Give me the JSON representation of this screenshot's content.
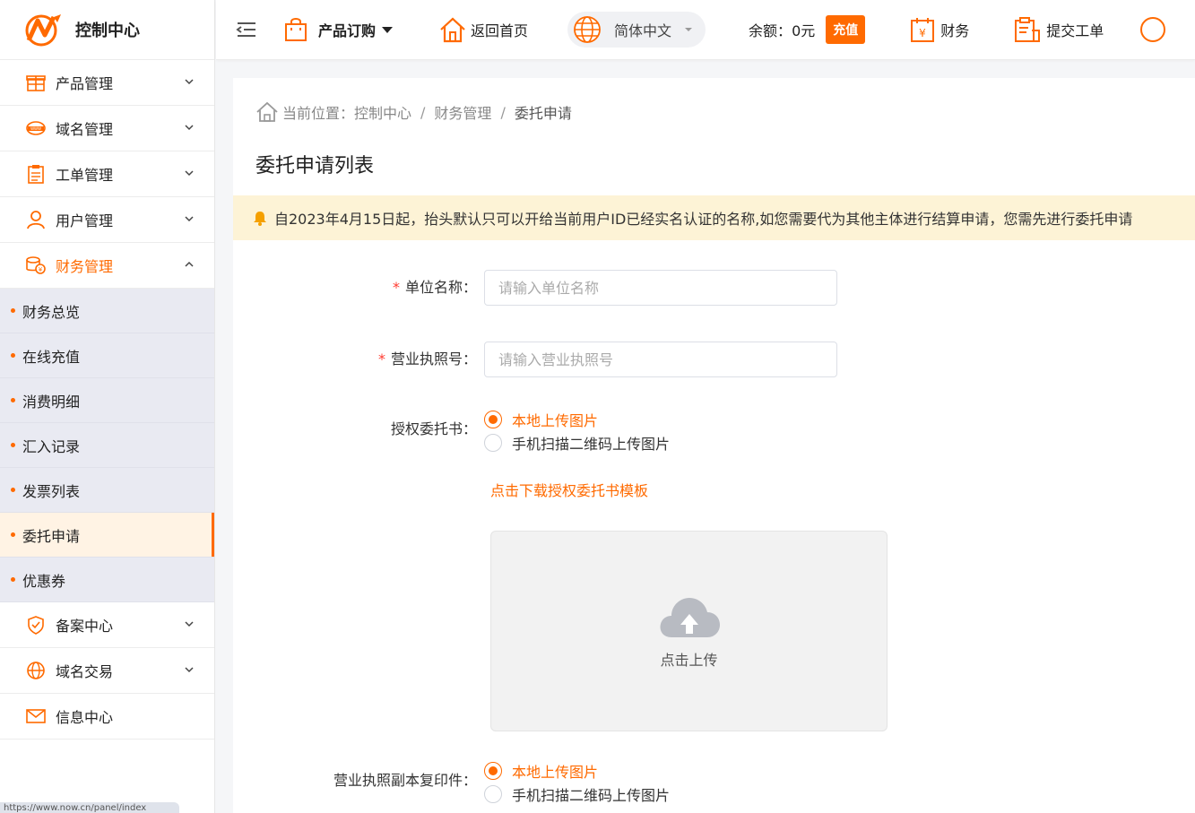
{
  "app": {
    "title": "控制中心"
  },
  "topbar": {
    "product_order": "产品订购",
    "home": "返回首页",
    "language": "简体中文",
    "balance_label": "余额：",
    "balance_value": "0元",
    "recharge": "充值",
    "finance": "财务",
    "ticket": "提交工单"
  },
  "sidebar": {
    "items": [
      {
        "label": "产品管理",
        "icon": "gift-box-icon"
      },
      {
        "label": "域名管理",
        "icon": "domain-icon"
      },
      {
        "label": "工单管理",
        "icon": "clipboard-icon"
      },
      {
        "label": "用户管理",
        "icon": "user-icon"
      },
      {
        "label": "财务管理",
        "icon": "coins-icon"
      },
      {
        "label": "备案中心",
        "icon": "shield-icon"
      },
      {
        "label": "域名交易",
        "icon": "globe-icon"
      },
      {
        "label": "信息中心",
        "icon": "mail-icon"
      }
    ],
    "finance_sub": [
      "财务总览",
      "在线充值",
      "消费明细",
      "汇入记录",
      "发票列表",
      "委托申请",
      "优惠券"
    ]
  },
  "status_bar": {
    "url": "https://www.now.cn/panel/index"
  },
  "breadcrumb": {
    "prefix": "当前位置：",
    "items": [
      "控制中心",
      "财务管理",
      "委托申请"
    ],
    "separator": "/"
  },
  "page": {
    "title": "委托申请列表",
    "notice": "自2023年4月15日起，抬头默认只可以开给当前用户ID已经实名认证的名称,如您需要代为其他主体进行结算申请，您需先进行委托申请"
  },
  "form": {
    "company_label": "单位名称：",
    "company_placeholder": "请输入单位名称",
    "license_label": "营业执照号：",
    "license_placeholder": "请输入营业执照号",
    "authorization_label": "授权委托书：",
    "option_local": "本地上传图片",
    "option_qr": "手机扫描二维码上传图片",
    "download_template": "点击下载授权委托书模板",
    "upload_label": "点击上传",
    "license_copy_label": "营业执照副本复印件："
  },
  "colors": {
    "accent": "#ff6a00",
    "notice_bg": "#fdf3d6",
    "submenu_bg": "#e9eaf2"
  }
}
